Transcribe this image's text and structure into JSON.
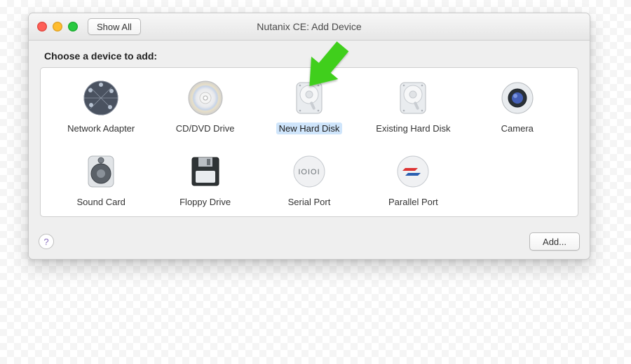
{
  "window": {
    "title": "Nutanix CE: Add Device",
    "show_all": "Show All"
  },
  "heading": "Choose a device to add:",
  "devices": [
    {
      "label": "Network Adapter"
    },
    {
      "label": "CD/DVD Drive"
    },
    {
      "label": "New Hard Disk",
      "selected": true
    },
    {
      "label": "Existing Hard Disk"
    },
    {
      "label": "Camera"
    },
    {
      "label": "Sound Card"
    },
    {
      "label": "Floppy Drive"
    },
    {
      "label": "Serial Port"
    },
    {
      "label": "Parallel Port"
    }
  ],
  "footer": {
    "help": "?",
    "add": "Add..."
  },
  "annotation": {
    "arrow_target": "New Hard Disk",
    "arrow_color": "#3fcf1f"
  }
}
